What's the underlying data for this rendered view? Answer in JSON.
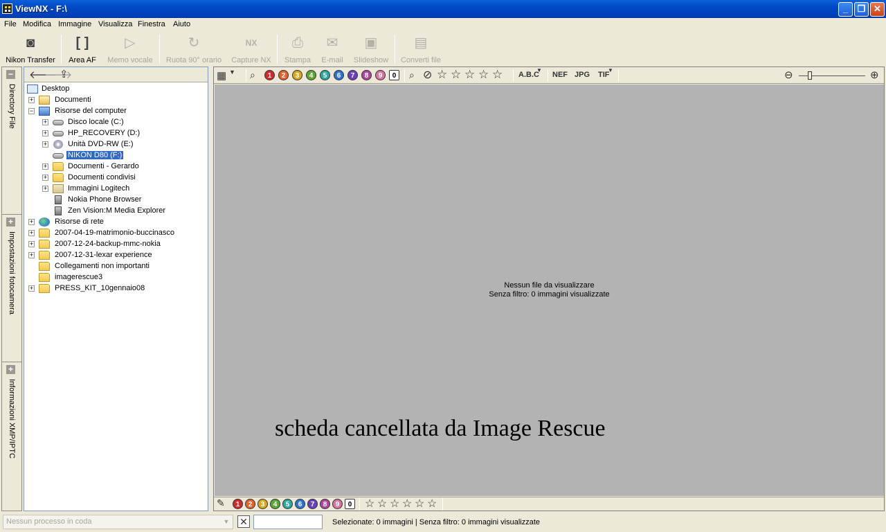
{
  "window": {
    "title": "ViewNX - F:\\"
  },
  "menu": [
    "File",
    "Modifica",
    "Immagine",
    "Visualizza",
    "Finestra",
    "Aiuto"
  ],
  "toolbar": {
    "nikon_transfer": "Nikon Transfer",
    "area_af": "Area AF",
    "memo_vocale": "Memo vocale",
    "ruota": "Ruota 90° orario",
    "capture_nx": "Capture NX",
    "stampa": "Stampa",
    "email": "E-mail",
    "slideshow": "Slideshow",
    "converti": "Converti file"
  },
  "side_tabs": {
    "directory": "Directory File",
    "impostazioni": "Impostazioni fotocamera",
    "info": "Informazioni XMP/IPTC"
  },
  "tree": [
    {
      "label": "Desktop",
      "icon": "desktop-icon"
    },
    {
      "label": "Documenti",
      "icon": "folder-icon"
    },
    {
      "label": "Risorse del computer",
      "icon": "computer-icon"
    },
    {
      "label": "Disco locale (C:)",
      "icon": "drive-icon"
    },
    {
      "label": "HP_RECOVERY (D:)",
      "icon": "drive-icon"
    },
    {
      "label": "Unità DVD-RW (E:)",
      "icon": "dvd-icon"
    },
    {
      "label": "NIKON D80 (F:)",
      "icon": "drive-icon",
      "selected": true
    },
    {
      "label": "Documenti - Gerardo",
      "icon": "folder-icon"
    },
    {
      "label": "Documenti condivisi",
      "icon": "folder-icon"
    },
    {
      "label": "Immagini Logitech",
      "icon": "logitech-folder-icon"
    },
    {
      "label": "Nokia Phone Browser",
      "icon": "phone-icon"
    },
    {
      "label": "Zen Vision:M Media Explorer",
      "icon": "media-player-icon"
    },
    {
      "label": "Risorse di rete",
      "icon": "network-icon"
    },
    {
      "label": "2007-04-19-matrimonio-buccinasco",
      "icon": "folder-icon"
    },
    {
      "label": "2007-12-24-backup-mmc-nokia",
      "icon": "folder-icon"
    },
    {
      "label": "2007-12-31-lexar experience",
      "icon": "folder-icon"
    },
    {
      "label": "Collegamenti non importanti",
      "icon": "folder-icon"
    },
    {
      "label": "imagerescue3",
      "icon": "folder-icon"
    },
    {
      "label": "PRESS_KIT_10gennaio08",
      "icon": "folder-icon"
    }
  ],
  "filters": {
    "labels": [
      "1",
      "2",
      "3",
      "4",
      "5",
      "6",
      "7",
      "8",
      "9",
      "0"
    ],
    "label_colors": [
      "#d22a2a",
      "#e5622a",
      "#d8a81f",
      "#5aa832",
      "#2aa8a0",
      "#2a72d8",
      "#6a3fc0",
      "#b0459f",
      "#d8729f",
      "#ffffff"
    ],
    "rating_nums": [
      "1",
      "2",
      "3",
      "4",
      "5"
    ],
    "abc": "A.B.C",
    "nef": "NEF",
    "jpg": "JPG",
    "tif": "TIF"
  },
  "viewer": {
    "empty_line1": "Nessun file da visualizzare",
    "empty_line2": "Senza filtro: 0 immagini visualizzate"
  },
  "caption": "scheda cancellata da Image Rescue",
  "status": {
    "queue_placeholder": "Nessun processo in coda",
    "text": "Selezionate: 0 immagini | Senza filtro: 0 immagini visualizzate"
  }
}
